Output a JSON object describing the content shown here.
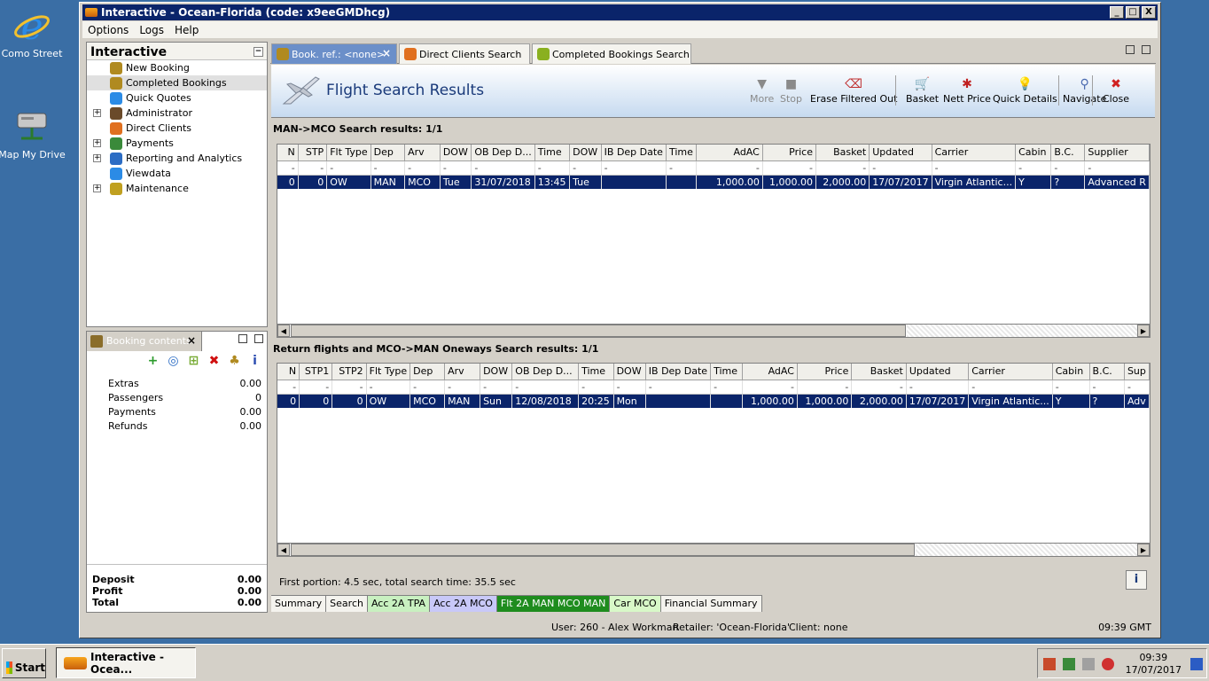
{
  "desktop": {
    "icons": [
      {
        "label": "Como Street",
        "icon": "internet-explorer-icon"
      },
      {
        "label": "Map My Drive",
        "icon": "network-drive-icon"
      }
    ]
  },
  "window": {
    "title": "Interactive - Ocean-Florida (code: x9eeGMDhcg)",
    "controls": [
      "_",
      "□",
      "X"
    ]
  },
  "menu": [
    "Options",
    "Logs",
    "Help"
  ],
  "nav": {
    "title": "Interactive",
    "items": [
      {
        "label": "New Booking",
        "icon": "palm-tree-icon",
        "expandable": false,
        "selected": false
      },
      {
        "label": "Completed Bookings",
        "icon": "palm-tree-icon",
        "expandable": false,
        "selected": true
      },
      {
        "label": "Quick Quotes",
        "icon": "clock-icon",
        "expandable": false,
        "selected": false
      },
      {
        "label": "Administrator",
        "icon": "admin-person-icon",
        "expandable": true,
        "selected": false
      },
      {
        "label": "Direct Clients",
        "icon": "clients-icon",
        "expandable": false,
        "selected": false
      },
      {
        "label": "Payments",
        "icon": "money-icon",
        "expandable": true,
        "selected": false
      },
      {
        "label": "Reporting and Analytics",
        "icon": "chart-icon",
        "expandable": true,
        "selected": false
      },
      {
        "label": "Viewdata",
        "icon": "globe-icon",
        "expandable": false,
        "selected": false
      },
      {
        "label": "Maintenance",
        "icon": "wrench-icon",
        "expandable": true,
        "selected": false
      }
    ]
  },
  "booking": {
    "tab_label": "Booking contents",
    "rows": [
      {
        "label": "Extras",
        "value": "0.00"
      },
      {
        "label": "Passengers",
        "value": "0"
      },
      {
        "label": "Payments",
        "value": "0.00"
      },
      {
        "label": "Refunds",
        "value": "0.00"
      }
    ],
    "summary": [
      {
        "label": "Deposit",
        "value": "0.00"
      },
      {
        "label": "Profit",
        "value": "0.00"
      },
      {
        "label": "Total",
        "value": "0.00"
      }
    ]
  },
  "tabs": [
    {
      "label": "Book. ref.: <none>",
      "active": true
    },
    {
      "label": "Direct Clients Search",
      "active": false
    },
    {
      "label": "Completed Bookings Search",
      "active": false
    }
  ],
  "header": {
    "title": "Flight Search Results",
    "toolbar": [
      {
        "label": "More",
        "glyph": "▼",
        "disabled": true
      },
      {
        "label": "Stop",
        "glyph": "■",
        "disabled": true
      },
      {
        "label": "Erase Filtered Out",
        "glyph": "⌫",
        "disabled": false
      },
      {
        "label": "Basket",
        "glyph": "🛒",
        "disabled": false
      },
      {
        "label": "Nett Price",
        "glyph": "✱",
        "disabled": false
      },
      {
        "label": "Quick Details",
        "glyph": "💡",
        "disabled": false
      },
      {
        "label": "Navigate",
        "glyph": "⚲",
        "disabled": false
      },
      {
        "label": "Close",
        "glyph": "✖",
        "disabled": false
      }
    ]
  },
  "grid1": {
    "title": "MAN->MCO Search results: 1/1",
    "columns": [
      "N",
      "STP",
      "Flt Type",
      "Dep",
      "Arv",
      "DOW",
      "OB Dep D...",
      "Time",
      "DOW",
      "IB Dep Date",
      "Time",
      "AdAC",
      "Price",
      "Basket",
      "Updated",
      "Carrier",
      "Cabin",
      "B.C.",
      "Supplier"
    ],
    "filter": [
      "-",
      "-",
      "-",
      "-",
      "-",
      "-",
      "-",
      "-",
      "-",
      "-",
      "-",
      "-",
      "-",
      "-",
      "-",
      "-",
      "-",
      "-",
      "-"
    ],
    "rows": [
      [
        "0",
        "0",
        "OW",
        "MAN",
        "MCO",
        "Tue",
        "31/07/2018",
        "13:45",
        "Tue",
        "",
        "",
        "1,000.00",
        "1,000.00",
        "2,000.00",
        "17/07/2017",
        "Virgin Atlantic...",
        "Y",
        "?",
        "Advanced R"
      ]
    ]
  },
  "grid2": {
    "title": "Return flights and MCO->MAN Oneways Search results: 1/1",
    "columns": [
      "N",
      "STP1",
      "STP2",
      "Flt Type",
      "Dep",
      "Arv",
      "DOW",
      "OB Dep D...",
      "Time",
      "DOW",
      "IB Dep Date",
      "Time",
      "AdAC",
      "Price",
      "Basket",
      "Updated",
      "Carrier",
      "Cabin",
      "B.C.",
      "Sup"
    ],
    "filter": [
      "-",
      "-",
      "-",
      "-",
      "-",
      "-",
      "-",
      "-",
      "-",
      "-",
      "-",
      "-",
      "-",
      "-",
      "-",
      "-",
      "-",
      "-",
      "-",
      "-"
    ],
    "rows": [
      [
        "0",
        "0",
        "0",
        "OW",
        "MCO",
        "MAN",
        "Sun",
        "12/08/2018",
        "20:25",
        "Mon",
        "",
        "",
        "1,000.00",
        "1,000.00",
        "2,000.00",
        "17/07/2017",
        "Virgin Atlantic...",
        "Y",
        "?",
        "Adv"
      ]
    ]
  },
  "status_line": "First portion: 4.5 sec, total search time: 35.5 sec",
  "bottom_tabs": [
    {
      "label": "Summary",
      "bg": "#f4f3ee",
      "fg": "#000000"
    },
    {
      "label": "Search",
      "bg": "#f4f3ee",
      "fg": "#000000"
    },
    {
      "label": "Acc 2A TPA",
      "bg": "#c8f0c0",
      "fg": "#000000"
    },
    {
      "label": "Acc 2A MCO",
      "bg": "#c8c8f8",
      "fg": "#000000"
    },
    {
      "label": "Flt 2A MAN MCO MAN",
      "bg": "#1e8c1e",
      "fg": "#ffffff"
    },
    {
      "label": "Car MCO",
      "bg": "#d8f8c8",
      "fg": "#000000"
    },
    {
      "label": "Financial Summary",
      "bg": "#f4f3ee",
      "fg": "#000000"
    }
  ],
  "statusbar": {
    "user": "User: 260 - Alex Workman",
    "retailer": "Retailer: 'Ocean-Florida'",
    "client": "Client: none",
    "time": "09:39 GMT"
  },
  "taskbar": {
    "start": "Start",
    "task": "Interactive - Ocea...",
    "clock_time": "09:39",
    "clock_date": "17/07/2017"
  }
}
